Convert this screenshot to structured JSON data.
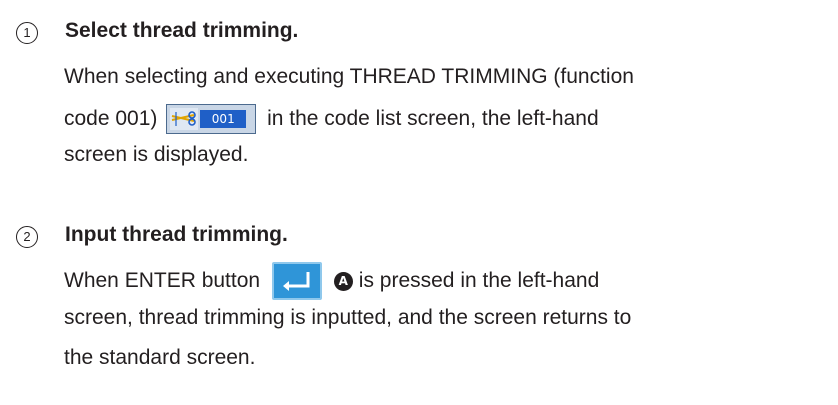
{
  "steps": [
    {
      "number": "1",
      "heading": "Select thread trimming.",
      "line1": "When selecting and executing THREAD TRIMMING (function",
      "line2_before": "code 001)",
      "line2_after": "in the code list screen, the left-hand",
      "line3": "screen is displayed."
    },
    {
      "number": "2",
      "heading": "Input thread trimming.",
      "line1_before": "When ENTER button",
      "line1_after": "is pressed in the left-hand",
      "line2": "screen, thread trimming is inputted, and the screen returns to",
      "line3": "the standard screen."
    }
  ],
  "code_button": {
    "icon": "scissors-icon",
    "code": "001"
  },
  "enter_button": {
    "icon": "enter-arrow-icon"
  },
  "badge_label": "A",
  "colors": {
    "text": "#231f20",
    "code_bg": "#1f5fc7",
    "enter_bg": "#2f95d8"
  }
}
